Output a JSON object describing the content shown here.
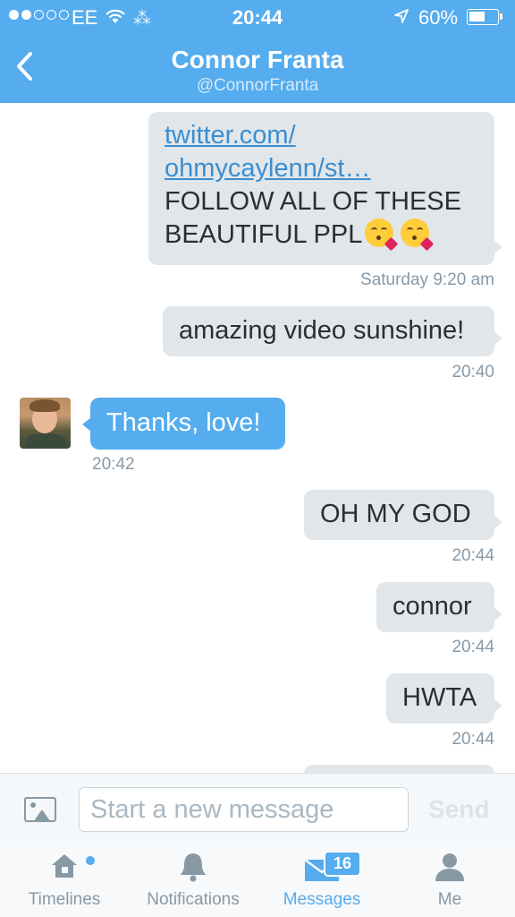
{
  "status_bar": {
    "carrier": "EE",
    "time": "20:44",
    "battery": "60%",
    "battery_level": 0.6,
    "activity": "⁂"
  },
  "header": {
    "title": "Connor Franta",
    "subtitle": "@ConnorFranta",
    "back_icon": "chevron-left-icon"
  },
  "messages": [
    {
      "direction": "outgoing",
      "link_line1": "twitter.com/",
      "link_line2": "ohmycaylenn/st…",
      "text_line1": "FOLLOW ALL OF THESE",
      "text_line2": "BEAUTIFUL PPL",
      "emoji": "kissing-face-emoji",
      "timestamp": "Saturday 9:20 am"
    },
    {
      "direction": "outgoing",
      "text": "amazing video sunshine!",
      "timestamp": "20:40"
    },
    {
      "direction": "incoming",
      "text": "Thanks, love!",
      "timestamp": "20:42"
    },
    {
      "direction": "outgoing",
      "text": "OH MY GOD",
      "timestamp": "20:44"
    },
    {
      "direction": "outgoing",
      "text": "connor",
      "timestamp": "20:44"
    },
    {
      "direction": "outgoing",
      "text": "HWTA",
      "timestamp": "20:44"
    }
  ],
  "composer": {
    "placeholder": "Start a new message",
    "send_label": "Send",
    "photo_icon": "photo-icon"
  },
  "tabs": [
    {
      "label": "Timelines",
      "icon": "home-icon"
    },
    {
      "label": "Notifications",
      "icon": "bell-icon"
    },
    {
      "label": "Messages",
      "icon": "envelope-icon",
      "badge": "16",
      "active": true
    },
    {
      "label": "Me",
      "icon": "person-icon"
    }
  ],
  "colors": {
    "accent": "#55acee",
    "bubble_out": "#e1e6ea",
    "text": "#292f33",
    "muted": "#8899a6"
  }
}
